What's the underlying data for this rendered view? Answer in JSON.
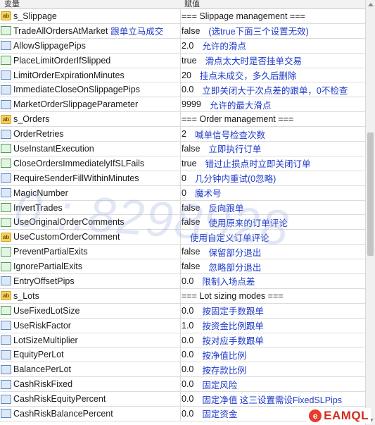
{
  "columns": {
    "variable": "变量",
    "value": "赋值"
  },
  "rows": [
    {
      "icon": "ab",
      "name": "s_Slippage",
      "note": "",
      "value": "=== Slippage management ===",
      "vnote": ""
    },
    {
      "icon": "chk",
      "name": "TradeAllOrdersAtMarket",
      "note": "跟单立马成交",
      "value": "false",
      "vnote": "(选true下面三个设置无效)"
    },
    {
      "icon": "num",
      "name": "AllowSlippagePips",
      "note": "",
      "value": "2.0",
      "vnote": "允许的滑点"
    },
    {
      "icon": "chk",
      "name": "PlaceLimitOrderIfSlipped",
      "note": "",
      "value": "true",
      "vnote": "滑点太大时是否挂单交易"
    },
    {
      "icon": "num",
      "name": "LimitOrderExpirationMinutes",
      "note": "",
      "value": "20",
      "vnote": "挂点未成交，多久后删除"
    },
    {
      "icon": "num",
      "name": "ImmediateCloseOnSlippagePips",
      "note": "",
      "value": "0.0",
      "vnote": "立即关闭大于次点差的跟单，0不检查"
    },
    {
      "icon": "num",
      "name": "MarketOrderSlippageParameter",
      "note": "",
      "value": "9999",
      "vnote": "允许的最大滑点"
    },
    {
      "icon": "ab",
      "name": "s_Orders",
      "note": "",
      "value": "=== Order management ===",
      "vnote": ""
    },
    {
      "icon": "num",
      "name": "OrderRetries",
      "note": "",
      "value": "2",
      "vnote": "喊单信号检查次数"
    },
    {
      "icon": "chk",
      "name": "UseInstantExecution",
      "note": "",
      "value": "false",
      "vnote": "立即执行订单"
    },
    {
      "icon": "chk",
      "name": "CloseOrdersImmediatelyIfSLFails",
      "note": "",
      "value": "true",
      "vnote": "错过止损点时立即关闭订单"
    },
    {
      "icon": "num",
      "name": "RequireSenderFillWithinMinutes",
      "note": "",
      "value": "0",
      "vnote": "几分钟内重试(0忽略)"
    },
    {
      "icon": "num",
      "name": "MagicNumber",
      "note": "",
      "value": "0",
      "vnote": "魔术号"
    },
    {
      "icon": "chk",
      "name": "InvertTrades",
      "note": "",
      "value": "false",
      "vnote": "反向跟单"
    },
    {
      "icon": "chk",
      "name": "UseOriginalOrderComments",
      "note": "",
      "value": "false",
      "vnote": "使用原来的订单评论"
    },
    {
      "icon": "ab",
      "name": "UseCustomOrderComment",
      "note": "",
      "value": "",
      "vnote": "使用自定义订单评论"
    },
    {
      "icon": "chk",
      "name": "PreventPartialExits",
      "note": "",
      "value": "false",
      "vnote": "保留部分退出"
    },
    {
      "icon": "chk",
      "name": "IgnorePartialExits",
      "note": "",
      "value": "false",
      "vnote": "忽略部分退出"
    },
    {
      "icon": "num",
      "name": "EntryOffsetPips",
      "note": "",
      "value": "0.0",
      "vnote": "限制入场点差"
    },
    {
      "icon": "ab",
      "name": "s_Lots",
      "note": "",
      "value": "=== Lot sizing modes ===",
      "vnote": ""
    },
    {
      "icon": "chk",
      "name": "UseFixedLotSize",
      "note": "",
      "value": "0.0",
      "vnote": "按固定手数跟单"
    },
    {
      "icon": "num",
      "name": "UseRiskFactor",
      "note": "",
      "value": "1.0",
      "vnote": "按资金比例跟单"
    },
    {
      "icon": "num",
      "name": "LotSizeMultiplier",
      "note": "",
      "value": "0.0",
      "vnote": "按对应手数跟单"
    },
    {
      "icon": "num",
      "name": "EquityPerLot",
      "note": "",
      "value": "0.0",
      "vnote": "按净值比例"
    },
    {
      "icon": "num",
      "name": "BalancePerLot",
      "note": "",
      "value": "0.0",
      "vnote": "按存款比例"
    },
    {
      "icon": "num",
      "name": "CashRiskFixed",
      "note": "",
      "value": "0.0",
      "vnote": "固定风险"
    },
    {
      "icon": "num",
      "name": "CashRiskEquityPercent",
      "note": "",
      "value": "0.0",
      "vnote": "固定净值 这三设置需设FixedSLPips"
    },
    {
      "icon": "num",
      "name": "CashRiskBalancePercent",
      "note": "",
      "value": "0.0",
      "vnote": "固定资金"
    }
  ],
  "watermark": "0.:.8298928",
  "logo": {
    "mark": "e",
    "text": "EAMQL"
  }
}
